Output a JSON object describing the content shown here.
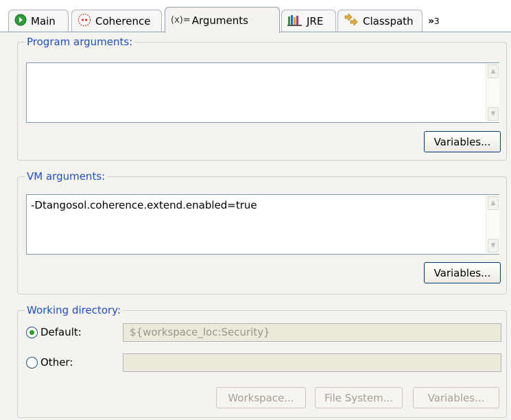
{
  "tabs": [
    {
      "label": "Main",
      "icon": "main-run-icon"
    },
    {
      "label": "Coherence",
      "icon": "coherence-icon"
    },
    {
      "label": "Arguments",
      "icon": "arguments-icon",
      "active": true
    },
    {
      "label": "JRE",
      "icon": "jre-library-icon"
    },
    {
      "label": "Classpath",
      "icon": "classpath-icon"
    }
  ],
  "tabs_overflow": {
    "chevron": "»",
    "count": "3"
  },
  "arguments_icon_text": "(x)=",
  "program_args": {
    "title": "Program arguments:",
    "value": "",
    "variables_button": "Variables..."
  },
  "vm_args": {
    "title": "VM arguments:",
    "value": "-Dtangosol.coherence.extend.enabled=true",
    "variables_button": "Variables..."
  },
  "working_dir": {
    "title": "Working directory:",
    "default_label": "Default:",
    "default_value": "${workspace_loc:Security}",
    "other_label": "Other:",
    "other_value": "",
    "selected": "default",
    "workspace_button": "Workspace...",
    "filesystem_button": "File System...",
    "variables_button": "Variables..."
  },
  "colors": {
    "group_title": "#1c4fd0",
    "panel_bg": "#f4f3ef",
    "button_border": "#003c74",
    "radio_dot": "#21a121"
  }
}
